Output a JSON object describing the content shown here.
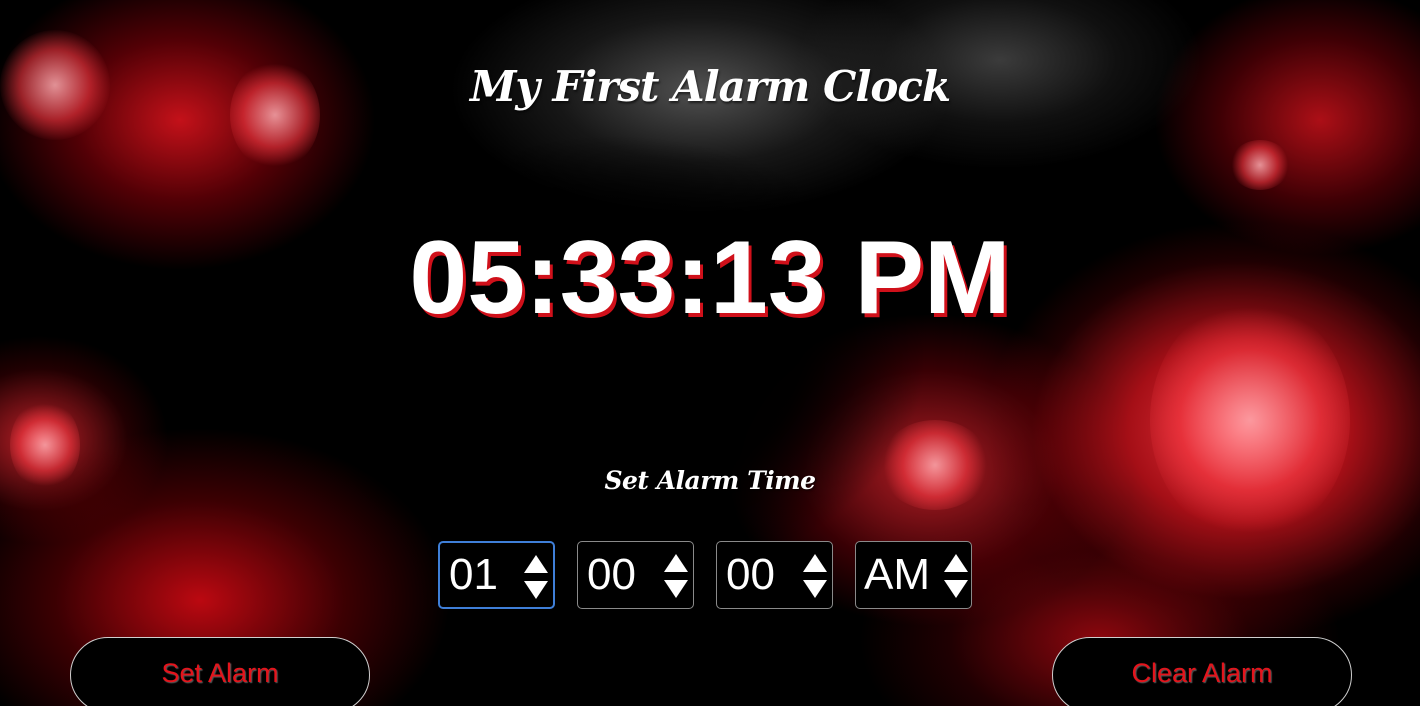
{
  "header": {
    "title": "My First Alarm Clock"
  },
  "clock": {
    "time": "05:33:13 PM"
  },
  "alarm": {
    "label": "Set Alarm Time",
    "hour": "01",
    "minute": "00",
    "second": "00",
    "period": "AM"
  },
  "buttons": {
    "set_label": "Set Alarm",
    "clear_label": "Clear Alarm"
  },
  "colors": {
    "accent": "#e4141c",
    "focus_ring": "#3f7fd8",
    "text": "#ffffff",
    "background": "#000000"
  },
  "icons": {
    "spin": "up-down-arrows-icon"
  }
}
